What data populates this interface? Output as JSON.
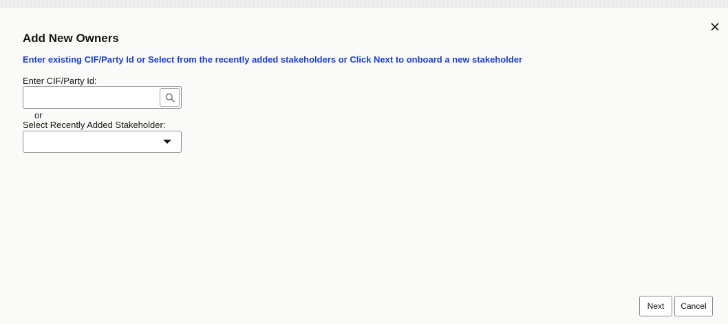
{
  "dialog": {
    "title": "Add New Owners",
    "instruction": "Enter existing CIF/Party Id or Select from the recently added stakeholders or Click Next to onboard a new stakeholder",
    "close_icon": "close-icon"
  },
  "cif_field": {
    "label": "Enter CIF/Party Id:",
    "value": "",
    "placeholder": "",
    "search_icon": "search-icon"
  },
  "separator": {
    "text": "or"
  },
  "stakeholder_select": {
    "label": "Select Recently Added Stakeholder:",
    "selected_value": "",
    "caret_icon": "caret-down-icon"
  },
  "footer": {
    "next_label": "Next",
    "cancel_label": "Cancel"
  },
  "colors": {
    "instruction_text": "#1a3ed8",
    "dialog_background": "#fafaf9",
    "border": "#8d8b88"
  }
}
